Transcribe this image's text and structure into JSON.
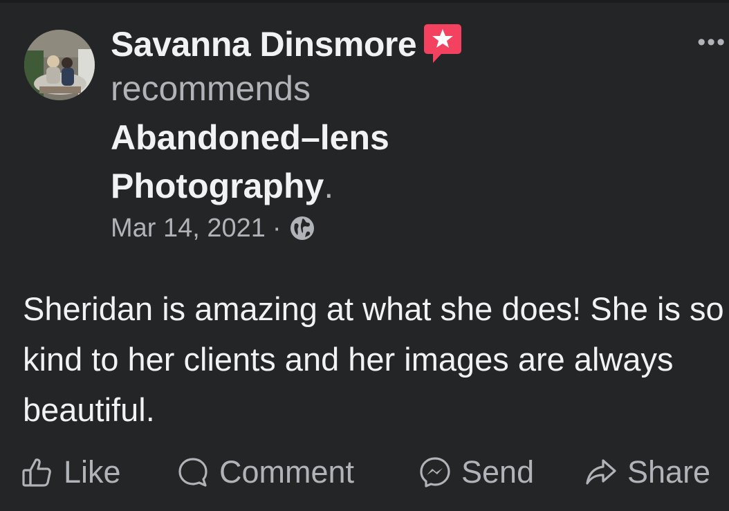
{
  "post": {
    "author": "Savanna Dinsmore",
    "verb": "recommends",
    "page_name": "Abandoned–lens Photography",
    "page_suffix": ".",
    "date": "Mar 14, 2021",
    "separator": "·",
    "privacy_icon": "globe-icon",
    "author_badge_icon": "star-speech-bubble-icon",
    "more_label": "•••",
    "text": "Sheridan is amazing at what she does! She is so kind to her clients and her images are always beautiful."
  },
  "actions": [
    {
      "label": "Like",
      "icon": "thumbs-up-icon"
    },
    {
      "label": "Comment",
      "icon": "comment-bubble-icon"
    },
    {
      "label": "Send",
      "icon": "messenger-icon"
    },
    {
      "label": "Share",
      "icon": "share-arrow-icon"
    }
  ],
  "colors": {
    "background": "#242526",
    "primary_text": "#f1f2f4",
    "secondary_text": "#b0b3b8",
    "badge": "#f3425f"
  }
}
